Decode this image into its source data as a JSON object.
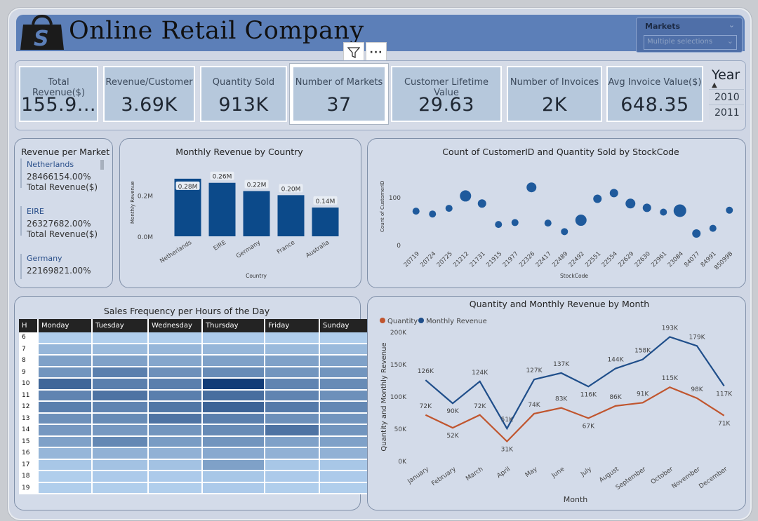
{
  "app": {
    "title": "Online Retail Company"
  },
  "colors": {
    "header": "#5c7fb8",
    "bar": "#0c4a8a",
    "revenue_line": "#1f4e8a",
    "quantity_line": "#c0552e",
    "card_bg": "#b6c8dc"
  },
  "slicer": {
    "label": "Markets",
    "placeholder": "Multiple selections"
  },
  "toolbar": {
    "filter_icon": "filter-icon",
    "more_icon": "more-options-icon",
    "more_label": "···"
  },
  "kpis": [
    {
      "label": "Total Revenue($)",
      "value": "155.9..."
    },
    {
      "label": "Revenue/Customer",
      "value": "3.69K"
    },
    {
      "label": "Quantity Sold",
      "value": "913K"
    },
    {
      "label": "Number of Markets",
      "value": "37"
    },
    {
      "label": "Customer Lifetime Value",
      "value": "29.63"
    },
    {
      "label": "Number of Invoices",
      "value": "2K"
    },
    {
      "label": "Avg Invoice Value($)",
      "value": "648.35"
    }
  ],
  "year_slicer": {
    "title": "Year",
    "sort_arrow": "▲",
    "items": [
      "2010",
      "2011"
    ]
  },
  "revenue_per_market": {
    "title": "Revenue per Market",
    "items": [
      {
        "name": "Netherlands",
        "value": "28466154.00%",
        "sub": "Total Revenue($)"
      },
      {
        "name": "EIRE",
        "value": "26327682.00%",
        "sub": "Total Revenue($)"
      },
      {
        "name": "Germany",
        "value": "22169821.00%"
      }
    ]
  },
  "heatmap": {
    "title": "Sales Frequency per Hours of the Day",
    "hour_header": "H",
    "days": [
      "Monday",
      "Tuesday",
      "Wednesday",
      "Thursday",
      "Friday",
      "Sunday"
    ],
    "hours": [
      "6",
      "7",
      "8",
      "9",
      "10",
      "11",
      "12",
      "13",
      "14",
      "15",
      "16",
      "17",
      "18",
      "19"
    ],
    "intensity": [
      [
        0.08,
        0.08,
        0.08,
        0.1,
        0.08,
        0.08
      ],
      [
        0.22,
        0.2,
        0.22,
        0.22,
        0.2,
        0.2
      ],
      [
        0.35,
        0.35,
        0.32,
        0.35,
        0.35,
        0.35
      ],
      [
        0.42,
        0.55,
        0.45,
        0.48,
        0.42,
        0.42
      ],
      [
        0.7,
        0.55,
        0.55,
        0.95,
        0.52,
        0.48
      ],
      [
        0.52,
        0.62,
        0.55,
        0.65,
        0.52,
        0.45
      ],
      [
        0.55,
        0.52,
        0.6,
        0.72,
        0.58,
        0.5
      ],
      [
        0.45,
        0.48,
        0.62,
        0.55,
        0.45,
        0.42
      ],
      [
        0.4,
        0.4,
        0.42,
        0.48,
        0.62,
        0.42
      ],
      [
        0.35,
        0.5,
        0.38,
        0.42,
        0.35,
        0.35
      ],
      [
        0.22,
        0.25,
        0.25,
        0.3,
        0.25,
        0.25
      ],
      [
        0.12,
        0.15,
        0.15,
        0.35,
        0.12,
        0.12
      ],
      [
        0.08,
        0.1,
        0.1,
        0.12,
        0.1,
        0.1
      ],
      [
        0.08,
        0.08,
        0.08,
        0.1,
        0.08,
        0.08
      ]
    ]
  },
  "chart_data": [
    {
      "type": "bar",
      "title": "Monthly Revenue by Country",
      "xlabel": "Country",
      "ylabel": "Monthly Revenue",
      "categories": [
        "Netherlands",
        "EIRE",
        "Germany",
        "France",
        "Australia"
      ],
      "values": [
        0.28,
        0.26,
        0.22,
        0.2,
        0.14
      ],
      "data_labels": [
        "0.28M",
        "0.26M",
        "0.22M",
        "0.20M",
        "0.14M"
      ],
      "yticks": [
        "0.0M",
        "0.2M"
      ],
      "ylim": [
        0,
        0.3
      ]
    },
    {
      "type": "scatter",
      "title": "Count of CustomerID and Quantity Sold by StockCode",
      "xlabel": "StockCode",
      "ylabel": "Count of CustomerID",
      "categories": [
        "20719",
        "20724",
        "20725",
        "21212",
        "21731",
        "21915",
        "21977",
        "22326",
        "22417",
        "22489",
        "22492",
        "22551",
        "22554",
        "22629",
        "22630",
        "22961",
        "23084",
        "84077",
        "84991",
        "85099B"
      ],
      "y_values": [
        72,
        66,
        78,
        104,
        88,
        44,
        48,
        122,
        47,
        29,
        53,
        98,
        110,
        88,
        79,
        70,
        73,
        25,
        36,
        74
      ],
      "sizes": [
        5,
        5,
        5,
        8,
        6,
        5,
        5,
        7,
        5,
        5,
        8,
        6,
        6,
        7,
        6,
        5,
        9,
        6,
        5,
        5
      ],
      "yticks": [
        "0",
        "100"
      ],
      "ylim": [
        0,
        140
      ]
    },
    {
      "type": "line",
      "title": "Quantity and Monthly Revenue by Month",
      "xlabel": "Month",
      "ylabel": "Quantity and Monthly Revenue",
      "categories": [
        "January",
        "February",
        "March",
        "April",
        "May",
        "June",
        "July",
        "August",
        "September",
        "October",
        "November",
        "December"
      ],
      "series": [
        {
          "name": "Quantity",
          "values": [
            72,
            52,
            72,
            31,
            74,
            83,
            67,
            86,
            91,
            115,
            98,
            71
          ],
          "labels": [
            "72K",
            "52K",
            "72K",
            "31K",
            "74K",
            "83K",
            "67K",
            "86K",
            "91K",
            "115K",
            "98K",
            "71K"
          ]
        },
        {
          "name": "Monthly Revenue",
          "values": [
            126,
            90,
            124,
            51,
            127,
            137,
            116,
            144,
            158,
            193,
            179,
            117
          ],
          "labels": [
            "126K",
            "90K",
            "124K",
            "51K",
            "127K",
            "137K",
            "116K",
            "144K",
            "158K",
            "193K",
            "179K",
            "117K"
          ]
        }
      ],
      "yticks": [
        "0K",
        "50K",
        "100K",
        "150K",
        "200K"
      ],
      "ylim": [
        0,
        200
      ]
    }
  ]
}
